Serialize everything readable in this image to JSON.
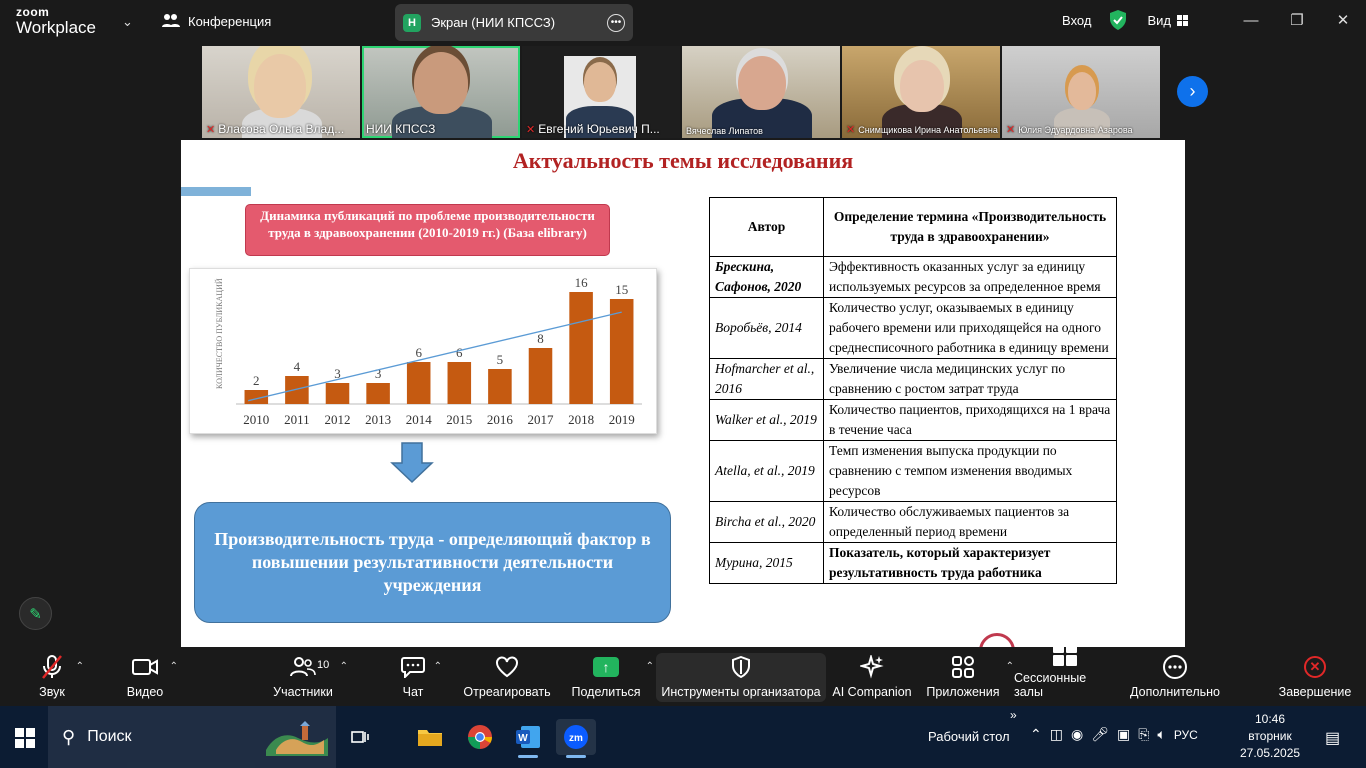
{
  "app": {
    "logo_line1": "zoom",
    "logo_line2": "Workplace",
    "meeting_title": "Конференция",
    "share_tab_letter": "Н",
    "share_tab_title": "Экран (НИИ КПССЗ)",
    "login": "Вход",
    "view": "Вид"
  },
  "participants": [
    {
      "name": "Власова Ольга Влад...",
      "muted": true,
      "active": false
    },
    {
      "name": "НИИ КПССЗ",
      "muted": false,
      "active": true
    },
    {
      "name": "Евгений Юрьевич П...",
      "muted": true,
      "active": false
    },
    {
      "name": "Вячеслав Липатов",
      "muted": false,
      "active": false
    },
    {
      "name": "Снимщикова Ирина Анатольевна",
      "muted": true,
      "active": false
    },
    {
      "name": "Юлия Эдуардовна Азарова",
      "muted": true,
      "active": false
    }
  ],
  "slide": {
    "title": "Актуальность темы исследования",
    "chart_caption": "Динамика публикаций по проблеме производительности труда в здравоохранении (2010-2019 гг.) (База elibrary)",
    "conclusion": "Производительность труда - определяющий фактор в повышении результативности деятельности учреждения",
    "table": {
      "headers": [
        "Автор",
        "Определение термина «Производительность труда в здравоохранении»"
      ],
      "rows": [
        {
          "author": "Брескина, Сафонов, 2020",
          "definition": "Эффективность оказанных услуг за единицу используемых ресурсов за определенное время",
          "bold_author": true,
          "bold_def": false
        },
        {
          "author": "Воробьёв, 2014",
          "definition": "Количество услуг, оказываемых в единицу рабочего времени или приходящейся на одного среднесписочного работника в единицу времени",
          "bold_author": false,
          "bold_def": false
        },
        {
          "author": "Hofmarcher et al., 2016",
          "definition": "Увеличение числа медицинских услуг по сравнению с ростом затрат труда",
          "bold_author": false,
          "bold_def": false
        },
        {
          "author": "Walker et al., 2019",
          "definition": "Количество пациентов, приходящихся на 1 врача в течение часа",
          "bold_author": false,
          "bold_def": false
        },
        {
          "author": "Atella, et al., 2019",
          "definition": "Темп изменения выпуска продукции по сравнению с темпом изменения вводимых ресурсов",
          "bold_author": false,
          "bold_def": false
        },
        {
          "author": "Bircha et al., 2020",
          "definition": "Количество обслуживаемых пациентов за определенный период времени",
          "bold_author": false,
          "bold_def": false
        },
        {
          "author": "Мурина, 2015",
          "definition": "Показатель, который характеризует результативность труда работника",
          "bold_author": false,
          "bold_def": true
        }
      ]
    }
  },
  "chart_data": {
    "type": "bar",
    "categories": [
      "2010",
      "2011",
      "2012",
      "2013",
      "2014",
      "2015",
      "2016",
      "2017",
      "2018",
      "2019"
    ],
    "values": [
      2,
      4,
      3,
      3,
      6,
      6,
      5,
      8,
      16,
      15
    ],
    "ylabel": "КОЛИЧЕСТВО ПУБЛИКАЦИЙ",
    "trendline": true,
    "bar_color": "#c55a11",
    "trend_color": "#5b9bd5"
  },
  "toolbar": {
    "audio": "Звук",
    "video": "Видео",
    "participants": "Участники",
    "participants_count": "10",
    "chat": "Чат",
    "react": "Отреагировать",
    "share": "Поделиться",
    "host_tools": "Инструменты организатора",
    "ai": "AI Companion",
    "apps": "Приложения",
    "breakout": "Сессионные залы",
    "more": "Дополнительно",
    "end": "Завершение"
  },
  "taskbar": {
    "search": "Поиск",
    "desktop": "Рабочий стол",
    "lang": "РУС",
    "time": "10:46",
    "day": "вторник",
    "date": "27.05.2025"
  }
}
